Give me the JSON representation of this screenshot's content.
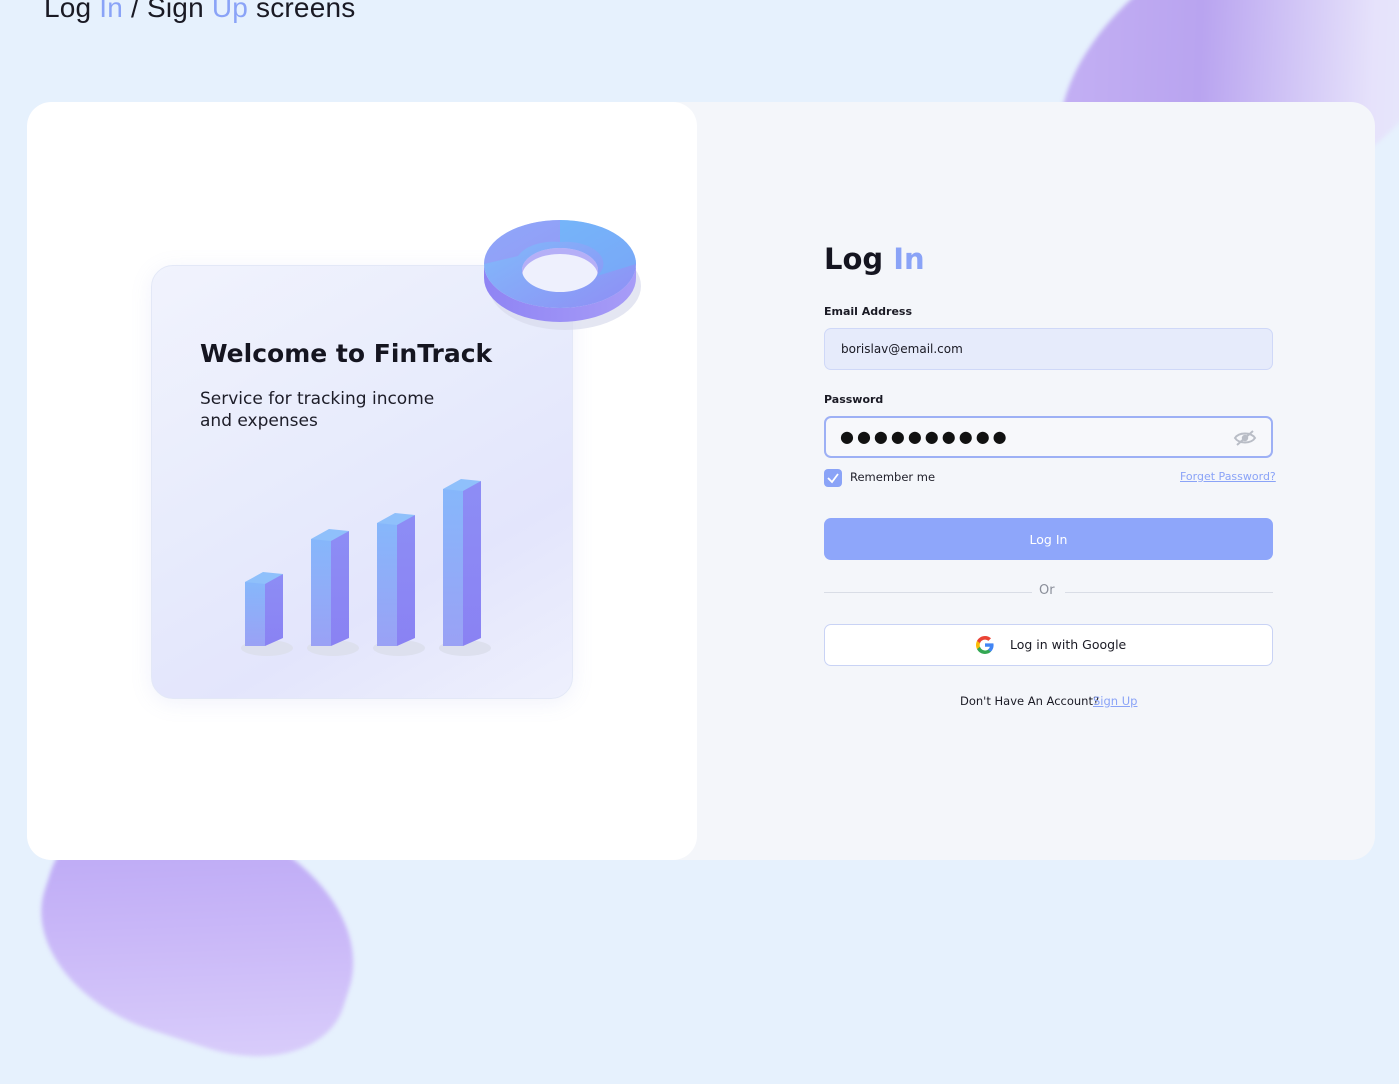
{
  "page": {
    "heading_parts": [
      "Log ",
      "In",
      " / Sign ",
      "Up",
      " screens"
    ]
  },
  "welcome": {
    "title": "Welcome to FinTrack",
    "subtitle": "Service for tracking income and expenses"
  },
  "login": {
    "title_main": "Log ",
    "title_accent": "In",
    "email_label": "Email Address",
    "email_value": "borislav@email.com",
    "password_label": "Password",
    "password_masked": "●●●●●●●●●●",
    "remember_label": "Remember me",
    "remember_checked": true,
    "forgot_link": "Forget Password?",
    "submit_label": "Log In",
    "divider_text": "Or",
    "google_label": "Log in with Google",
    "no_account_text": "Don't Have An Account?",
    "signup_link": "Sign Up"
  },
  "icons": {
    "password_toggle": "eye-slash-icon",
    "google": "google-icon",
    "checkbox": "check-icon"
  },
  "colors": {
    "accent": "#8aa3f7",
    "button": "#8ea6fa",
    "background": "#e6f1fd"
  }
}
